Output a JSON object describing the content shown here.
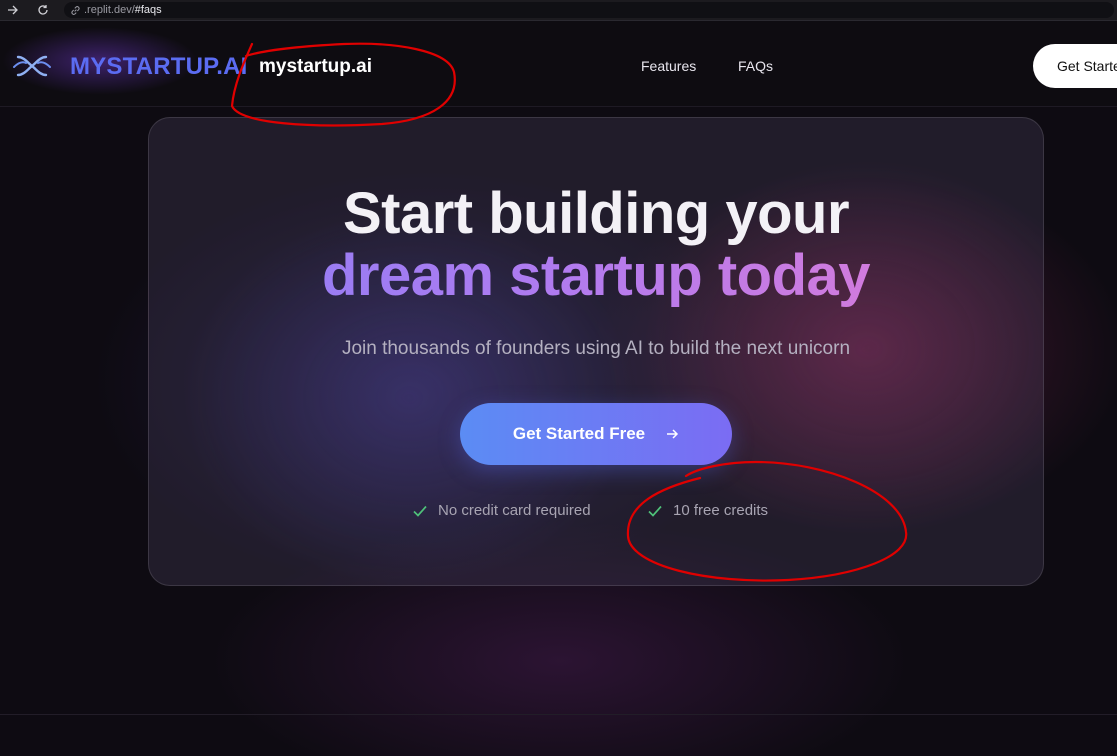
{
  "browser": {
    "url_host": ".replit.dev/",
    "url_path": "#faqs",
    "icons": [
      "forward-arrow-icon",
      "reload-icon",
      "link-icon"
    ]
  },
  "header": {
    "brand": "MYSTARTUP.AI",
    "brand_handwritten": "mystartup.ai",
    "nav": [
      "Features",
      "FAQs"
    ],
    "cta": "Get Started"
  },
  "hero": {
    "title_line1": "Start building your",
    "title_line2": "dream startup today",
    "subtitle": "Join thousands of founders using AI to build the next unicorn",
    "cta": "Get Started Free",
    "perks": [
      "No credit card required",
      "10 free credits"
    ]
  },
  "colors": {
    "brand_blue": "#5b6cf2",
    "gradient_start": "#8a7ef5",
    "gradient_end": "#e27bd3",
    "check_green": "#4fc27a",
    "annotation_red": "#e00000"
  }
}
